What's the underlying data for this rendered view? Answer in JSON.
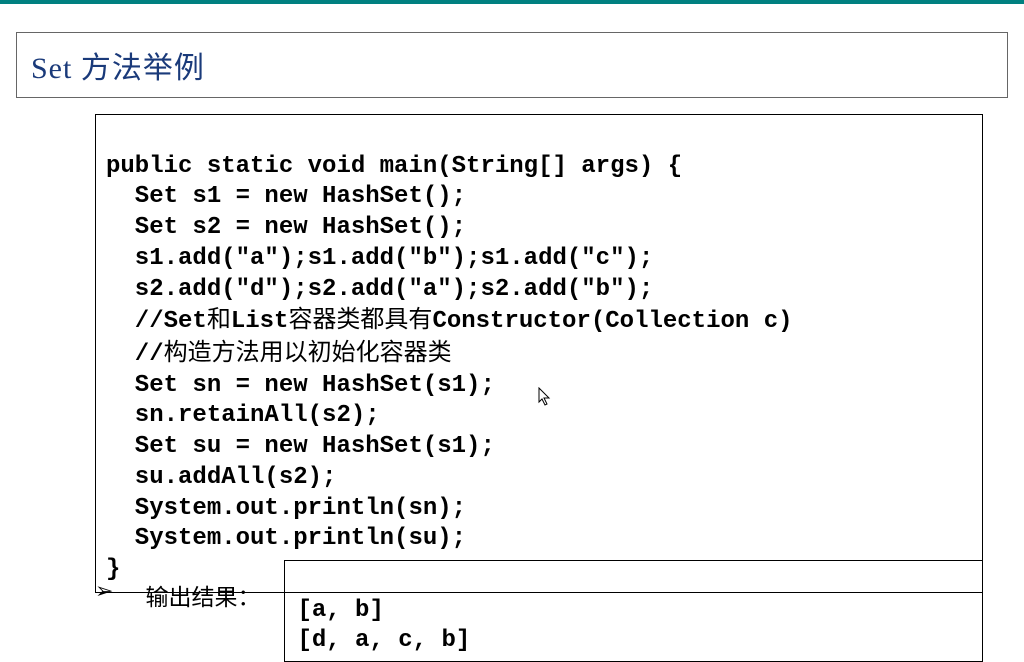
{
  "title": "Set 方法举例",
  "code": {
    "l0": "public static void main(String[] args) {",
    "l1": "  Set s1 = new HashSet();",
    "l2": "  Set s2 = new HashSet();",
    "l3": "  s1.add(\"a\");s1.add(\"b\");s1.add(\"c\");",
    "l4": "  s2.add(\"d\");s2.add(\"a\");s2.add(\"b\");",
    "l5a": "  //Set",
    "l5b": "和",
    "l5c": "List",
    "l5d": "容器类都具有",
    "l5e": "Constructor(Collection c)",
    "l6a": "  //",
    "l6b": "构造方法用以初始化容器类",
    "l7": "  Set sn = new HashSet(s1);",
    "l8": "  sn.retainAll(s2);",
    "l9": "  Set su = new HashSet(s1);",
    "l10": "  su.addAll(s2);",
    "l11": "  System.out.println(sn);",
    "l12": "  System.out.println(su);",
    "l13": "}"
  },
  "output_label": "输出结果：",
  "output": {
    "line1": "[a, b]",
    "line2": "[d, a, c, b]"
  }
}
